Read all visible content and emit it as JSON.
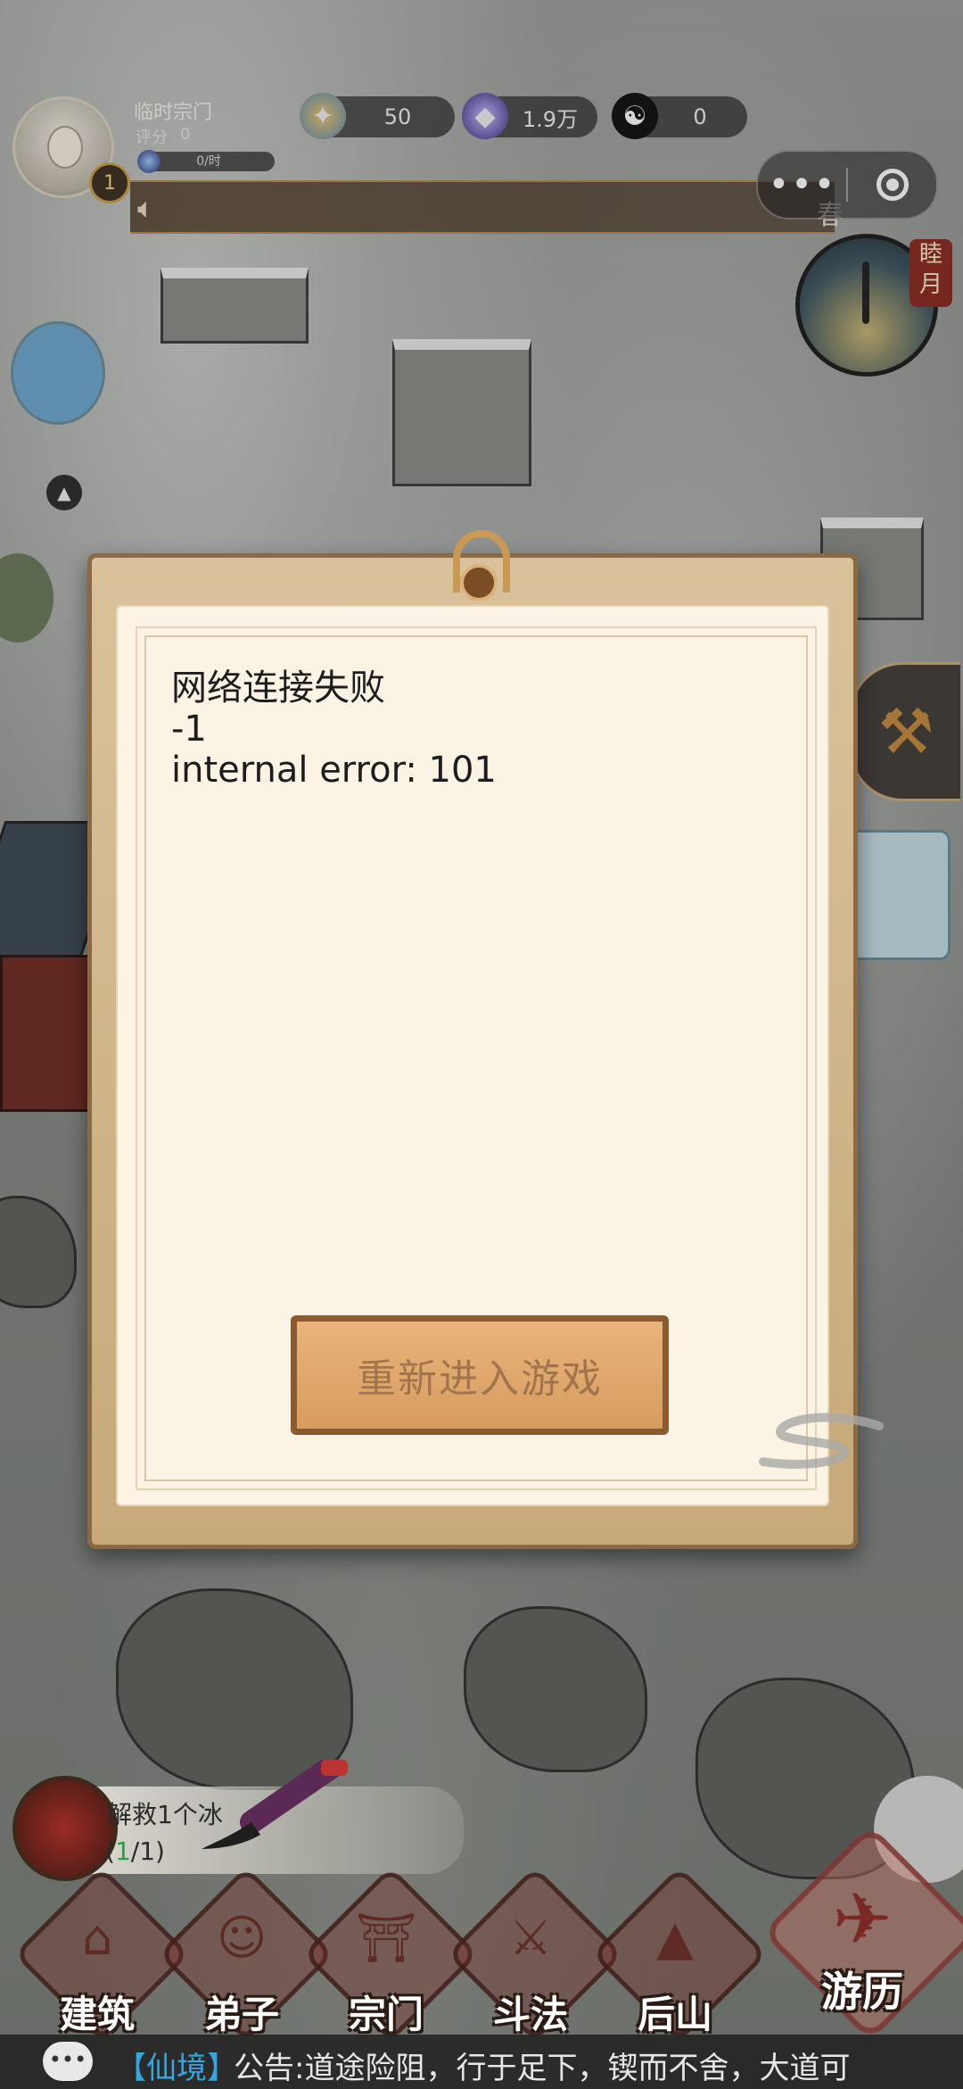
{
  "hud": {
    "sect_name": "临时宗门",
    "score_label": "评分",
    "score_value": "0",
    "rate_text": "0/时",
    "level": "1",
    "resources": [
      {
        "icon": "spirit-stone-icon",
        "value": "50"
      },
      {
        "icon": "crystal-icon",
        "value": "1.9万"
      },
      {
        "icon": "yin-yang-icon",
        "value": "0"
      }
    ],
    "season": "春",
    "month_tag": "睦月"
  },
  "dialog": {
    "message": "网络连接失败\n-1\ninternal error: 101",
    "button_label": "重新进入游戏"
  },
  "task": {
    "text": "解救1个冰",
    "progress_open": "(",
    "progress_done": "1",
    "progress_rest": "/1)"
  },
  "nav": [
    {
      "label": "建筑",
      "icon": "building-icon"
    },
    {
      "label": "弟子",
      "icon": "disciple-icon"
    },
    {
      "label": "宗门",
      "icon": "sect-gate-icon"
    },
    {
      "label": "斗法",
      "icon": "duel-icon"
    },
    {
      "label": "后山",
      "icon": "mountain-icon"
    },
    {
      "label": "游历",
      "icon": "travel-icon"
    }
  ],
  "ticker": {
    "channel": "【仙境】",
    "text": "公告:道途险阻，行于足下，锲而不舍，大道可"
  },
  "colors": {
    "ticker_channel": "#35a7e0",
    "button_fill": "#d79c5f",
    "paper": "#fbf4e4"
  }
}
